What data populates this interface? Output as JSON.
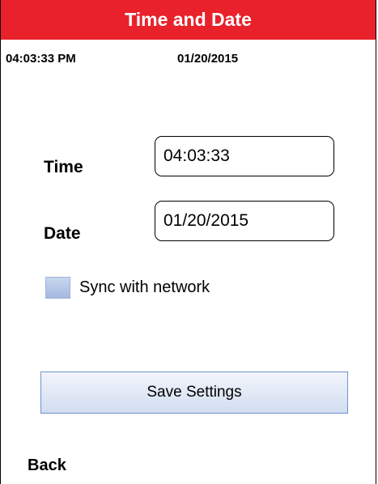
{
  "header": {
    "title": "Time and Date",
    "accent_color": "#e8212b"
  },
  "status": {
    "time": "04:03:33 PM",
    "date": "01/20/2015"
  },
  "form": {
    "time_label": "Time",
    "time_value": "04:03:33",
    "date_label": "Date",
    "date_value": "01/20/2015",
    "sync_label": "Sync with network",
    "sync_checked": false
  },
  "actions": {
    "save_label": "Save Settings",
    "back_label": "Back"
  }
}
